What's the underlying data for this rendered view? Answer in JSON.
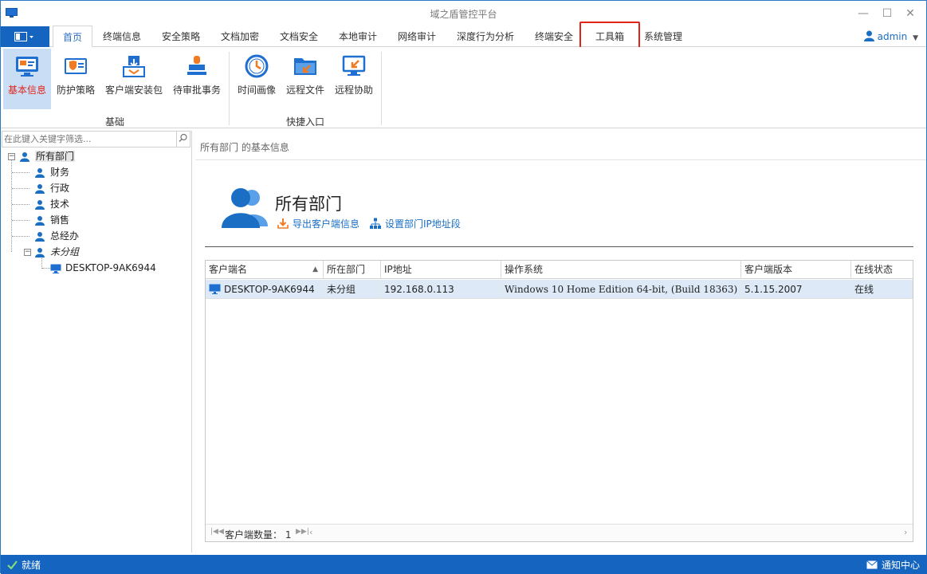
{
  "window": {
    "title": "域之盾管控平台"
  },
  "menu": {
    "tabs": [
      {
        "label": "首页"
      },
      {
        "label": "终端信息"
      },
      {
        "label": "安全策略"
      },
      {
        "label": "文档加密"
      },
      {
        "label": "文档安全"
      },
      {
        "label": "本地审计"
      },
      {
        "label": "网络审计"
      },
      {
        "label": "深度行为分析"
      },
      {
        "label": "终端安全"
      },
      {
        "label": "工具箱"
      },
      {
        "label": "系统管理"
      }
    ],
    "active": "首页",
    "highlighted": "工具箱",
    "user": "admin"
  },
  "ribbon": {
    "groups": [
      {
        "label": "基础",
        "buttons": [
          {
            "label": "基本信息",
            "icon": "basic-info-icon",
            "selected": true
          },
          {
            "label": "防护策略",
            "icon": "protection-policy-icon"
          },
          {
            "label": "客户端安装包",
            "icon": "client-package-icon"
          },
          {
            "label": "待审批事务",
            "icon": "pending-approval-icon"
          }
        ]
      },
      {
        "label": "快捷入口",
        "buttons": [
          {
            "label": "时间画像",
            "icon": "time-profile-icon"
          },
          {
            "label": "远程文件",
            "icon": "remote-file-icon"
          },
          {
            "label": "远程协助",
            "icon": "remote-assist-icon"
          }
        ]
      }
    ]
  },
  "tree": {
    "search_placeholder": "在此键入关键字筛选...",
    "root": "所有部门",
    "children": [
      "财务",
      "行政",
      "技术",
      "销售",
      "总经办",
      "未分组"
    ],
    "ungrouped_computer": "DESKTOP-9AK6944"
  },
  "detail": {
    "breadcrumb": "所有部门 的基本信息",
    "title": "所有部门",
    "export_link": "导出客户端信息",
    "ip_link": "设置部门IP地址段",
    "columns": [
      "客户端名",
      "所在部门",
      "IP地址",
      "操作系统",
      "客户端版本",
      "在线状态"
    ],
    "rows": [
      [
        "DESKTOP-9AK6944",
        "未分组",
        "192.168.0.113",
        "Windows 10 Home Edition 64-bit, (Build 18363)",
        "5.1.15.2007",
        "在线"
      ]
    ],
    "footer_label": "客户端数量：",
    "footer_count": "1"
  },
  "status": {
    "left": "就绪",
    "right": "通知中心"
  },
  "colors": {
    "accent": "#1565c0",
    "highlight": "#e2231a",
    "link": "#1a6fc4",
    "selection": "#dde9f7"
  }
}
